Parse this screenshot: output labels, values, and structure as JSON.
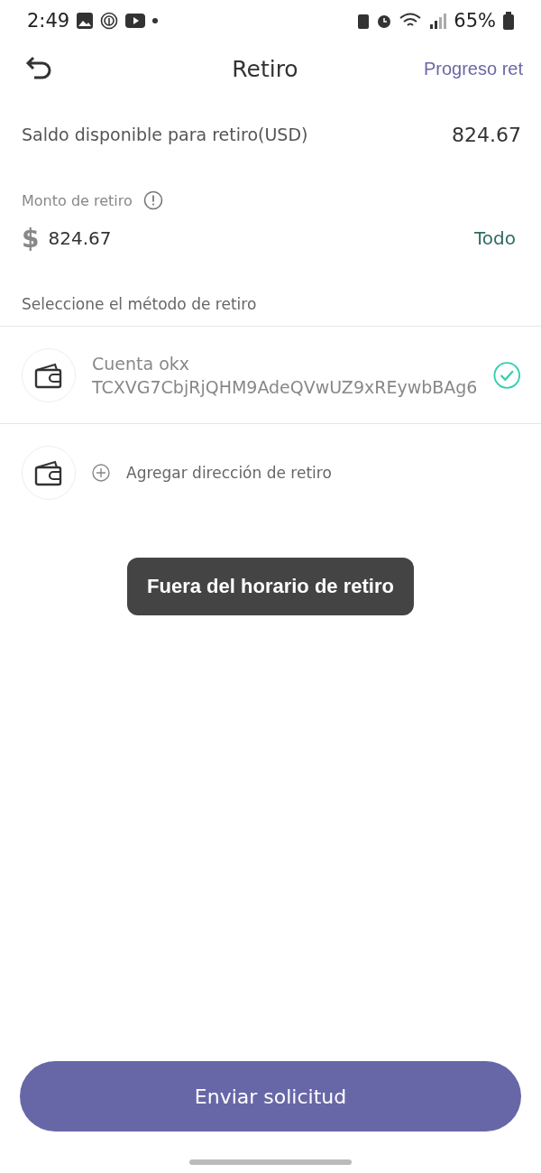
{
  "status_bar": {
    "time": "2:49",
    "battery": "65%"
  },
  "header": {
    "title": "Retiro",
    "link": "Progreso ret"
  },
  "balance": {
    "label": "Saldo disponible para retiro(USD)",
    "value": "824.67"
  },
  "amount": {
    "label": "Monto de retiro",
    "currency": "$",
    "value": "824.67",
    "all_button": "Todo"
  },
  "methods_label": "Seleccione el método de retiro",
  "methods": [
    {
      "kind": "account",
      "name": "Cuenta okx",
      "address": "TCXVG7CbjRjQHM9AdeQVwUZ9xREywbBAg6",
      "selected": true
    },
    {
      "kind": "add",
      "name": "Agregar dirección de retiro",
      "selected": false
    }
  ],
  "toast": "Fuera del horario de retiro",
  "submit_button": "Enviar solicitud"
}
